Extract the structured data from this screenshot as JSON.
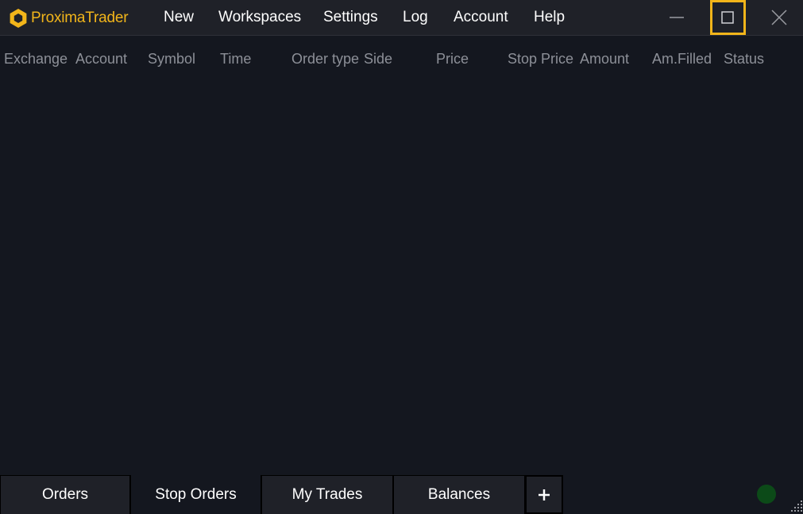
{
  "app": {
    "brand": "ProximaTrader",
    "brand_color": "#f2b51a",
    "background": "#14171f"
  },
  "menu": {
    "new": "New",
    "workspaces": "Workspaces",
    "settings": "Settings",
    "log": "Log",
    "account": "Account",
    "help": "Help"
  },
  "window_controls": {
    "minimize_icon": "minimize-icon",
    "maximize_icon": "maximize-icon",
    "close_icon": "close-icon",
    "highlight_color": "#f2b51a"
  },
  "table": {
    "columns": [
      "Exchange",
      "Account",
      "Symbol",
      "Time",
      "Order type",
      "Side",
      "Price",
      "Stop Price",
      "Amount",
      "Am.Filled",
      "Status"
    ],
    "rows": []
  },
  "tabs": [
    {
      "label": "Orders",
      "active": false
    },
    {
      "label": "Stop Orders",
      "active": true
    },
    {
      "label": "My Trades",
      "active": false
    },
    {
      "label": "Balances",
      "active": false
    }
  ],
  "add_tab_icon": "plus-icon",
  "status": {
    "indicator_color": "#0c4a18"
  }
}
